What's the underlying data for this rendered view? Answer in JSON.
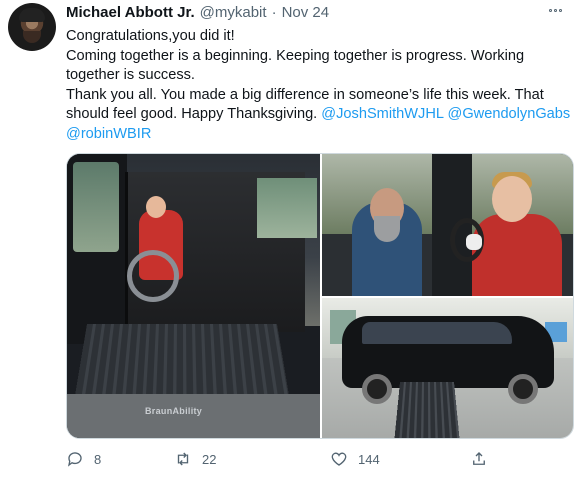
{
  "author": {
    "name": "Michael Abbott Jr.",
    "handle": "@mykabit",
    "separator": "·",
    "date": "Nov 24"
  },
  "tweet": {
    "line1": "Congratulations,you did it!",
    "line2": "Coming together is a beginning. Keeping together is progress. Working",
    "line3": "together is success.",
    "line4": "Thank you all. You made a big difference in someone’s life this week. That",
    "line5_text": "should feel good. Happy Thanksgiving.  ",
    "mention1": "@JoshSmithWJHL",
    "mention2": "@GwendolynGabs",
    "mention3": "@robinWBIR"
  },
  "media": {
    "left_brand": "BraunAbility"
  },
  "actions": {
    "replies": "8",
    "retweets": "22",
    "likes": "144"
  },
  "icons": [
    "more-icon",
    "reply-icon",
    "retweet-icon",
    "like-icon",
    "share-icon"
  ],
  "colors": {
    "link": "#1d9bf0",
    "muted": "#536471",
    "text": "#0f1419"
  }
}
